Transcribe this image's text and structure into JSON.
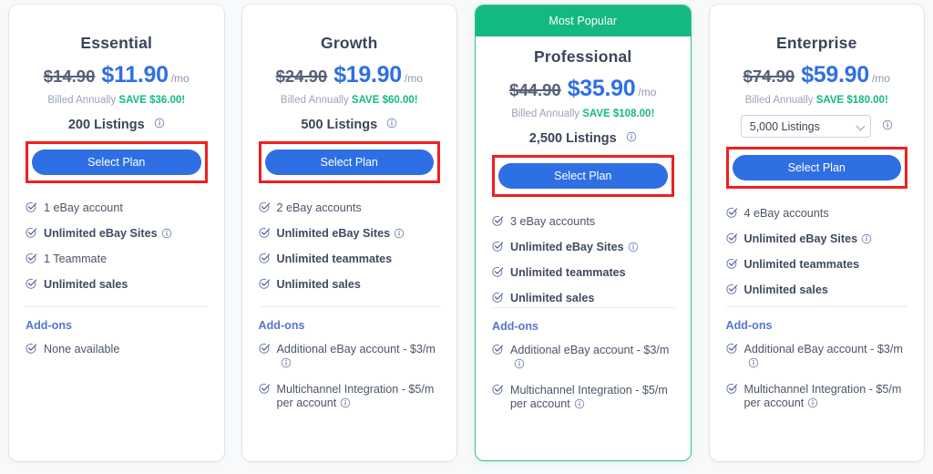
{
  "theme": {
    "accent_blue": "#2f6fe4",
    "accent_green": "#14b981",
    "annotation_red": "#ef2020",
    "page_background": "#f7f9fb"
  },
  "icons": {
    "check": "check-circle-icon",
    "info": "info-circle-icon",
    "chevron": "chevron-down-icon"
  },
  "labels": {
    "addons_heading": "Add-ons",
    "select_plan": "Select Plan",
    "per_month": "/mo",
    "billed_annually": "Billed Annually"
  },
  "plans": [
    {
      "name": "Essential",
      "price_old": "$14.90",
      "price_new": "$11.90",
      "per": "/mo",
      "billing": "Billed Annually",
      "save": "SAVE $36.00!",
      "listings_label": "200 Listings",
      "listings_is_select": false,
      "cta": "Select Plan",
      "featured": false,
      "badge": "",
      "features": [
        {
          "text": "1 eBay account",
          "bold": false,
          "info": false
        },
        {
          "text": "Unlimited eBay Sites",
          "bold": true,
          "info": true
        },
        {
          "text": "1 Teammate",
          "bold": false,
          "info": false
        },
        {
          "text": "Unlimited sales",
          "bold": true,
          "info": false
        }
      ],
      "addons": [
        {
          "text": "None available",
          "info": false
        }
      ]
    },
    {
      "name": "Growth",
      "price_old": "$24.90",
      "price_new": "$19.90",
      "per": "/mo",
      "billing": "Billed Annually",
      "save": "SAVE $60.00!",
      "listings_label": "500 Listings",
      "listings_is_select": false,
      "cta": "Select Plan",
      "featured": false,
      "badge": "",
      "features": [
        {
          "text": "2 eBay accounts",
          "bold": false,
          "info": false
        },
        {
          "text": "Unlimited eBay Sites",
          "bold": true,
          "info": true
        },
        {
          "text": "Unlimited teammates",
          "bold": true,
          "info": false
        },
        {
          "text": "Unlimited sales",
          "bold": true,
          "info": false
        }
      ],
      "addons": [
        {
          "text": "Additional eBay account - $3/m",
          "info": true
        },
        {
          "text": "Multichannel Integration - $5/m per account",
          "info": true
        }
      ]
    },
    {
      "name": "Professional",
      "price_old": "$44.90",
      "price_new": "$35.90",
      "per": "/mo",
      "billing": "Billed Annually",
      "save": "SAVE $108.00!",
      "listings_label": "2,500 Listings",
      "listings_is_select": false,
      "cta": "Select Plan",
      "featured": true,
      "badge": "Most Popular",
      "features": [
        {
          "text": "3 eBay accounts",
          "bold": false,
          "info": false
        },
        {
          "text": "Unlimited eBay Sites",
          "bold": true,
          "info": true
        },
        {
          "text": "Unlimited teammates",
          "bold": true,
          "info": false
        },
        {
          "text": "Unlimited sales",
          "bold": true,
          "info": false
        }
      ],
      "addons": [
        {
          "text": "Additional eBay account - $3/m",
          "info": true
        },
        {
          "text": "Multichannel Integration - $5/m per account",
          "info": true
        }
      ]
    },
    {
      "name": "Enterprise",
      "price_old": "$74.90",
      "price_new": "$59.90",
      "per": "/mo",
      "billing": "Billed Annually",
      "save": "SAVE $180.00!",
      "listings_label": "5,000 Listings",
      "listings_is_select": true,
      "listings_options": [
        "5,000 Listings"
      ],
      "cta": "Select Plan",
      "featured": false,
      "badge": "",
      "features": [
        {
          "text": "4 eBay accounts",
          "bold": false,
          "info": false
        },
        {
          "text": "Unlimited eBay Sites",
          "bold": true,
          "info": true
        },
        {
          "text": "Unlimited teammates",
          "bold": true,
          "info": false
        },
        {
          "text": "Unlimited sales",
          "bold": true,
          "info": false
        }
      ],
      "addons": [
        {
          "text": "Additional eBay account - $3/m",
          "info": true
        },
        {
          "text": "Multichannel Integration - $5/m per account",
          "info": true
        }
      ]
    }
  ]
}
